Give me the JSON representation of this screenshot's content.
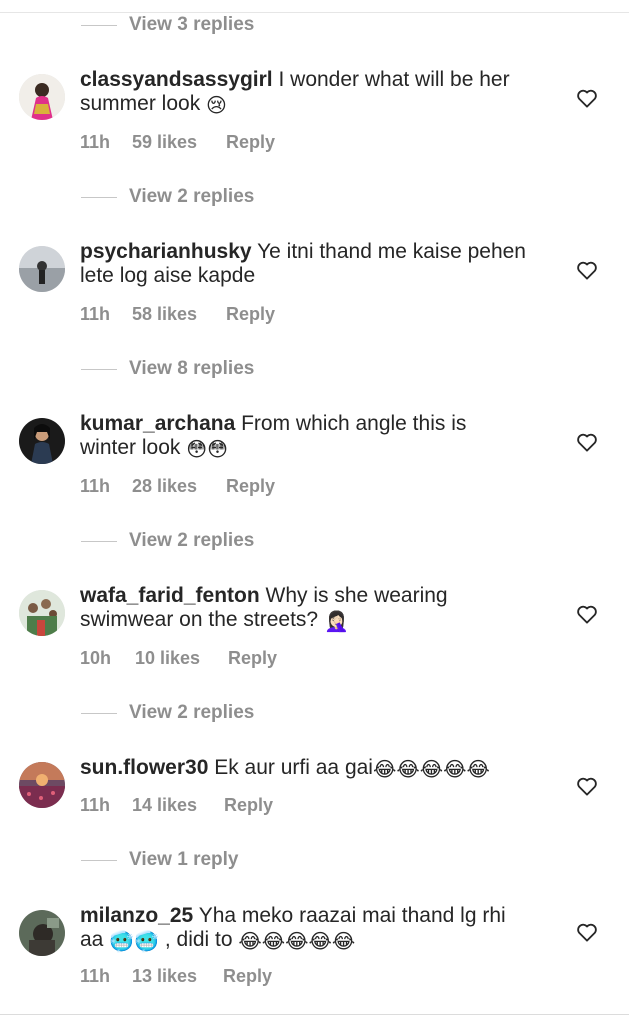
{
  "reply_threads": [
    {
      "label": "View 3 replies"
    },
    {
      "label": "View 2 replies"
    },
    {
      "label": "View 8 replies"
    },
    {
      "label": "View 2 replies"
    },
    {
      "label": "View 2 replies"
    },
    {
      "label": "View 1 reply"
    }
  ],
  "comments": [
    {
      "username": "classyandsassygirl",
      "text_line1": "I wonder what will be her",
      "text_line2": "summer look",
      "emojis_line2": "😢",
      "time": "11h",
      "likes": "59 likes",
      "reply": "Reply"
    },
    {
      "username": "psycharianhusky",
      "text_line1": "Ye itni thand me kaise pehen",
      "text_line2": "lete log aise kapde",
      "time": "11h",
      "likes": "58 likes",
      "reply": "Reply"
    },
    {
      "username": "kumar_archana",
      "text_line1": "From which angle this is",
      "text_line2": "winter look",
      "emojis_line2": "😳😳",
      "time": "11h",
      "likes": "28 likes",
      "reply": "Reply"
    },
    {
      "username": "wafa_farid_fenton",
      "text_line1": "Why is she wearing",
      "text_line2": "swimwear on the streets?",
      "emojis_line2": "🤦🏻‍♀️",
      "time": "10h",
      "likes": "10 likes",
      "reply": "Reply"
    },
    {
      "username": "sun.flower30",
      "text_line1": "Ek aur urfi aa gai",
      "emojis_line1": "😂😂😂😂😂",
      "time": "11h",
      "likes": "14 likes",
      "reply": "Reply"
    },
    {
      "username": "milanzo_25",
      "text_line1": "Yha meko raazai mai thand lg rhi",
      "text_line2a": "aa",
      "emojis_line2a": "🥶🥶",
      "text_line2b": ", didi to",
      "emojis_line2b": "😂😂😂😂😂",
      "time": "11h",
      "likes": "13 likes",
      "reply": "Reply"
    }
  ],
  "colors": {
    "text": "#262626",
    "muted": "#8e8e8e",
    "divider": "#c7c7c7"
  },
  "icons": {
    "like": "heart-outline-icon"
  }
}
